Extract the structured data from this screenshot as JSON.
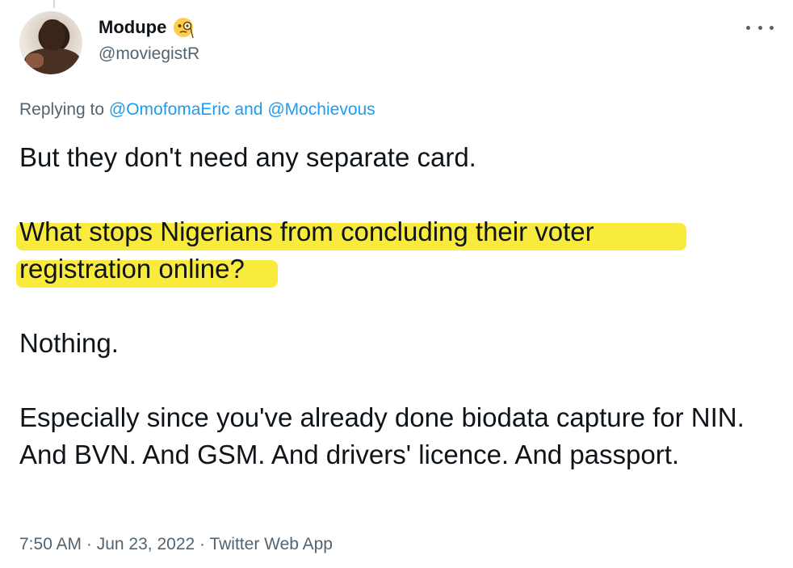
{
  "author": {
    "display_name": "Modupe",
    "handle": "@moviegistR",
    "name_emoji": "face-with-monocle-emoji"
  },
  "reply": {
    "prefix": "Replying to ",
    "mention_1": "@OmofomaEric",
    "conjunction": " and ",
    "mention_2": "@Mochievous"
  },
  "tweet": {
    "para_1": "But they don't need any separate card.",
    "para_2_line_1": "What stops Nigerians from concluding their voter",
    "para_2_line_2": "registration online?",
    "para_3": "Nothing.",
    "para_4": "Especially since you've already done biodata capture for NIN. And BVN. And GSM. And drivers' licence. And passport."
  },
  "meta": {
    "time": "7:50 AM",
    "separator_1": " · ",
    "date": "Jun 23, 2022",
    "separator_2": " · ",
    "source": "Twitter Web App"
  },
  "colors": {
    "highlight": "#f8e71c",
    "link": "#1d9bf0",
    "secondary_text": "#536471"
  }
}
